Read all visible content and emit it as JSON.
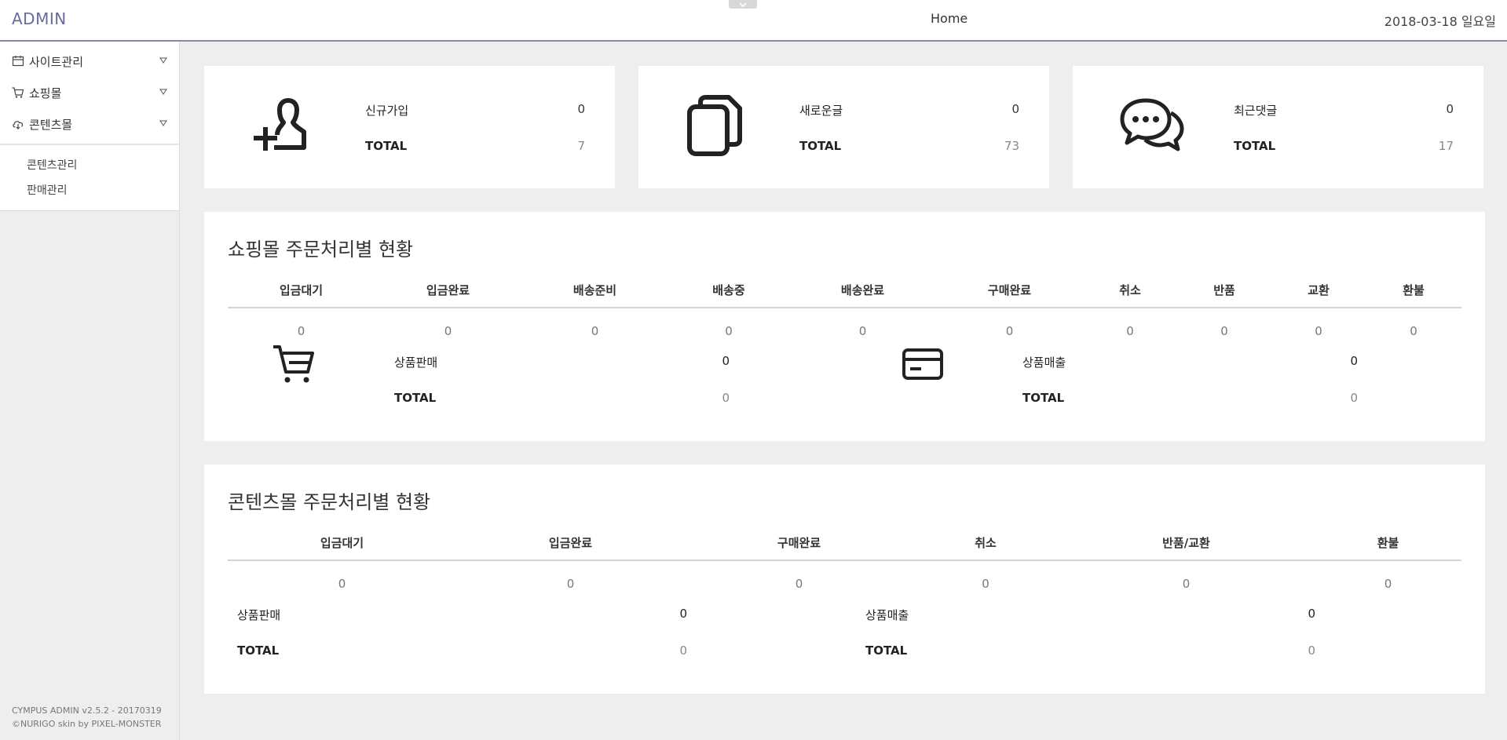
{
  "header": {
    "brand": "ADMIN",
    "home": "Home",
    "date": "2018-03-18 일요일"
  },
  "sidebar": {
    "items": [
      {
        "label": "사이트관리",
        "icon": "calendar-icon"
      },
      {
        "label": "쇼핑몰",
        "icon": "cart-icon"
      },
      {
        "label": "콘텐츠몰",
        "icon": "cloud-download-icon"
      }
    ],
    "subitems": [
      {
        "label": "콘텐츠관리"
      },
      {
        "label": "판매관리"
      }
    ],
    "footer": {
      "version": "CYMPUS ADMIN v2.5.2 - 20170319",
      "credit": "©NURIGO skin by PIXEL-MONSTER"
    }
  },
  "stats": [
    {
      "icon": "add-user-icon",
      "label": "신규가입",
      "value": "0",
      "total_label": "TOTAL",
      "total": "7"
    },
    {
      "icon": "documents-icon",
      "label": "새로운글",
      "value": "0",
      "total_label": "TOTAL",
      "total": "73"
    },
    {
      "icon": "chat-bubbles-icon",
      "label": "최근댓글",
      "value": "0",
      "total_label": "TOTAL",
      "total": "17"
    }
  ],
  "shop": {
    "title": "쇼핑몰 주문처리별 현황",
    "headers": [
      "입금대기",
      "입금완료",
      "배송준비",
      "배송중",
      "배송완료",
      "구매완료",
      "취소",
      "반품",
      "교환",
      "환불"
    ],
    "values": [
      "0",
      "0",
      "0",
      "0",
      "0",
      "0",
      "0",
      "0",
      "0",
      "0"
    ],
    "sales": {
      "label": "상품판매",
      "value": "0",
      "total_label": "TOTAL",
      "total": "0"
    },
    "revenue": {
      "label": "상품매출",
      "value": "0",
      "total_label": "TOTAL",
      "total": "0"
    }
  },
  "content": {
    "title": "콘텐츠몰 주문처리별 현황",
    "headers": [
      "입금대기",
      "입금완료",
      "구매완료",
      "취소",
      "반품/교환",
      "환불"
    ],
    "values": [
      "0",
      "0",
      "0",
      "0",
      "0",
      "0"
    ],
    "sales": {
      "label": "상품판매",
      "value": "0",
      "total_label": "TOTAL",
      "total": "0"
    },
    "revenue": {
      "label": "상품매출",
      "value": "0",
      "total_label": "TOTAL",
      "total": "0"
    }
  }
}
